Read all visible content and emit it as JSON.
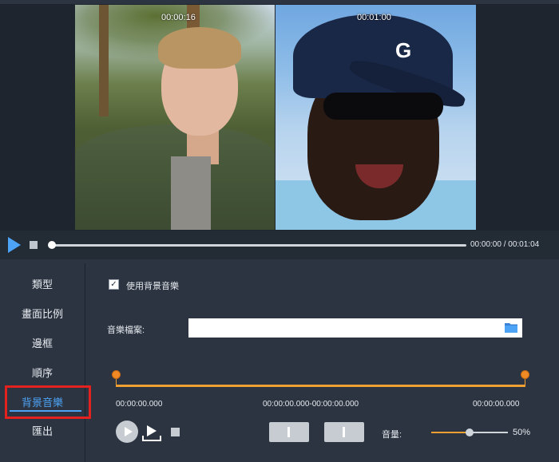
{
  "preview": {
    "left_timecode": "00:00:16",
    "right_timecode": "00:01:00",
    "cap_logo": "G",
    "time_display": "00:00:00 / 00:01:04"
  },
  "sidebar": {
    "items": [
      {
        "label": "類型"
      },
      {
        "label": "畫面比例"
      },
      {
        "label": "邊框"
      },
      {
        "label": "順序"
      },
      {
        "label": "背景音樂",
        "active": true
      },
      {
        "label": "匯出"
      }
    ]
  },
  "background_music": {
    "use_checkbox_label": "使用背景音樂",
    "use_checked": true,
    "check_mark": "✓",
    "file_label": "音樂檔案:",
    "file_value": "",
    "trim_start": "00:00:00.000",
    "trim_range": "00:00:00.000-00:00:00.000",
    "trim_end": "00:00:00.000",
    "volume_label": "音量:",
    "volume_value": "50%",
    "volume_level": 0.5
  },
  "colors": {
    "accent_blue": "#4da3f5",
    "accent_orange": "#f08a24",
    "highlight_red": "#e3211f",
    "panel_bg": "#2b3440"
  },
  "icons": [
    "play-icon",
    "stop-icon",
    "folder-icon",
    "round-play-icon",
    "play-range-icon",
    "mark-in-icon",
    "mark-out-icon"
  ]
}
